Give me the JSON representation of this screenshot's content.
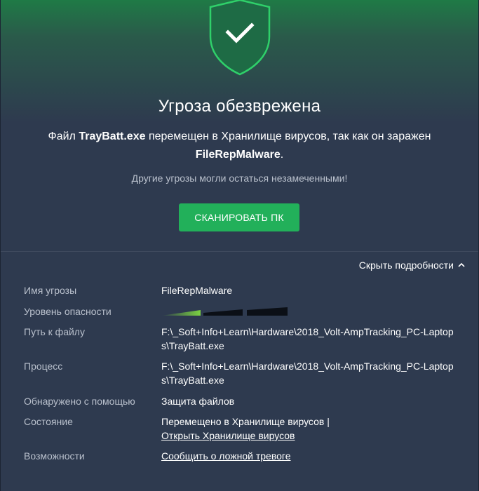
{
  "header": {
    "title": "Угроза обезврежена",
    "msg_prefix": "Файл ",
    "file_name": "TrayBatt.exe",
    "msg_middle": " перемещен в Хранилище вирусов, так как он заражен ",
    "threat_name": "FileRepMalware",
    "msg_suffix": ".",
    "warning": "Другие угрозы могли остаться незамеченными!",
    "scan_button": "СКАНИРОВАТЬ ПК",
    "shield_icon": "shield-check-icon",
    "accent_color": "#22b05a"
  },
  "details": {
    "toggle_label": "Скрыть подробности",
    "toggle_icon": "chevron-up-icon",
    "rows": {
      "threat_name": {
        "label": "Имя угрозы",
        "value": "FileRepMalware"
      },
      "severity": {
        "label": "Уровень опасности",
        "level_fraction": 0.33
      },
      "file_path": {
        "label": "Путь к файлу",
        "value": "F:\\_Soft+Info+Learn\\Hardware\\2018_Volt-AmpTracking_PC-Laptops\\TrayBatt.exe"
      },
      "process": {
        "label": "Процесс",
        "value": "F:\\_Soft+Info+Learn\\Hardware\\2018_Volt-AmpTracking_PC-Laptops\\TrayBatt.exe"
      },
      "detected_by": {
        "label": "Обнаружено с помощью",
        "value": "Защита файлов"
      },
      "status": {
        "label": "Состояние",
        "value": "Перемещено в Хранилище вирусов | ",
        "link": "Открыть Хранилище вирусов"
      },
      "options": {
        "label": "Возможности",
        "link": "Сообщить о ложной тревоге"
      }
    }
  }
}
